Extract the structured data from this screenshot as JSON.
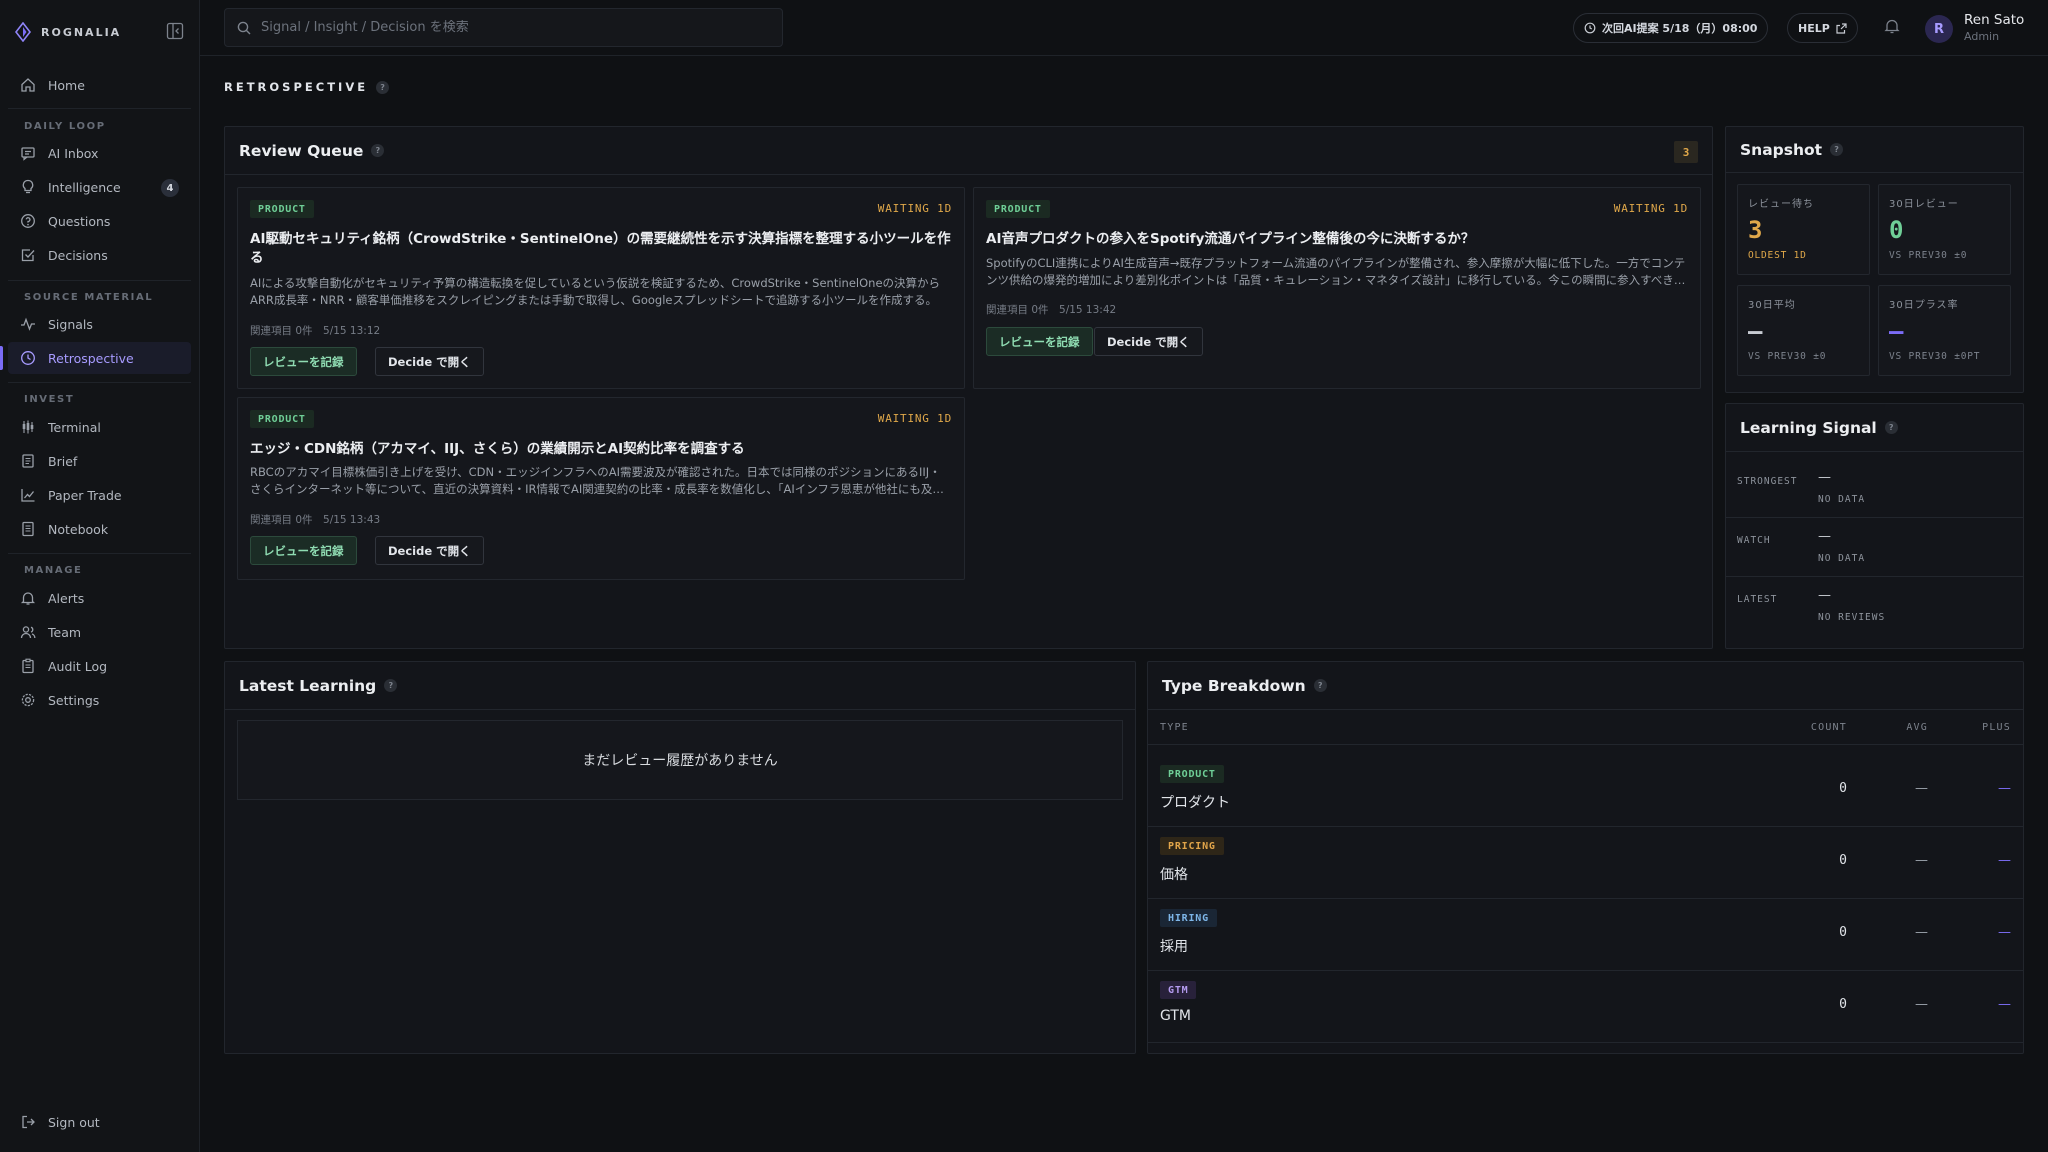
{
  "brand": {
    "name": "ROGNALIA",
    "accent": "#7b6cf6"
  },
  "sidebar": {
    "home": {
      "label": "Home",
      "icon": "home-icon"
    },
    "sections": {
      "daily_loop": "DAILY LOOP",
      "source_material": "SOURCE MATERIAL",
      "invest": "INVEST",
      "manage": "MANAGE"
    },
    "daily_loop": [
      {
        "label": "AI Inbox",
        "icon": "inbox-icon"
      },
      {
        "label": "Intelligence",
        "icon": "lightbulb-icon",
        "badge": "4"
      },
      {
        "label": "Questions",
        "icon": "question-icon"
      },
      {
        "label": "Decisions",
        "icon": "check-square-icon"
      }
    ],
    "source_material": [
      {
        "label": "Signals",
        "icon": "pulse-icon"
      },
      {
        "label": "Retrospective",
        "icon": "clock-icon",
        "active": true
      }
    ],
    "invest": [
      {
        "label": "Terminal",
        "icon": "candles-icon"
      },
      {
        "label": "Brief",
        "icon": "document-icon"
      },
      {
        "label": "Paper Trade",
        "icon": "chart-line-icon"
      },
      {
        "label": "Notebook",
        "icon": "notebook-icon"
      }
    ],
    "manage": [
      {
        "label": "Alerts",
        "icon": "bell-icon"
      },
      {
        "label": "Team",
        "icon": "users-icon"
      },
      {
        "label": "Audit Log",
        "icon": "clipboard-icon"
      },
      {
        "label": "Settings",
        "icon": "gear-icon"
      }
    ],
    "signout": "Sign out"
  },
  "topbar": {
    "search_placeholder": "Signal / Insight / Decision を検索",
    "next_ai": "次回AI提案 5/18（月）08:00",
    "help": "HELP",
    "user": {
      "initial": "R",
      "name": "Ren Sato",
      "role": "Admin"
    }
  },
  "page": {
    "title": "RETROSPECTIVE",
    "help": "?"
  },
  "review_queue": {
    "title": "Review Queue",
    "count": "3",
    "cards": [
      {
        "tag": "PRODUCT",
        "status": "WAITING 1D",
        "title": "AI駆動セキュリティ銘柄（CrowdStrike・SentinelOne）の需要継続性を示す決算指標を整理する小ツールを作る",
        "body": "AIによる攻撃自動化がセキュリティ予算の構造転換を促しているという仮説を検証するため、CrowdStrike・SentinelOneの決算からARR成長率・NRR・顧客単価推移をスクレイピングまたは手動で取得し、Googleスプレッドシートで追跡する小ツールを作成する。",
        "meta": "関連項目 0件　5/15 13:12",
        "btn_review": "レビューを記録",
        "btn_decide": "Decide で開く"
      },
      {
        "tag": "PRODUCT",
        "status": "WAITING 1D",
        "title": "AI音声プロダクトの参入をSpotify流通パイプライン整備後の今に決断するか？",
        "body": "SpotifyのCLI連携によりAI生成音声→既存プラットフォーム流通のパイプラインが整備され、参入摩擦が大幅に低下した。一方でコンテンツ供給の爆発的増加により差別化ポイントは「品質・キュレーション・マネタイズ設計」に移行している。今この瞬間に参入すべきか。",
        "meta": "関連項目 0件　5/15 13:42",
        "btn_review": "レビューを記録",
        "btn_decide": "Decide で開く"
      },
      {
        "tag": "PRODUCT",
        "status": "WAITING 1D",
        "title": "エッジ・CDN銘柄（アカマイ、IIJ、さくら）の業績開示とAI契約比率を調査する",
        "body": "RBCのアカマイ目標株価引き上げを受け、CDN・エッジインフラへのAI需要波及が確認された。日本では同様のポジションにあるIIJ・さくらインターネット等について、直近の決算資料・IR情報でAI関連契約の比率・成長率を数値化し、「AIインフラ恩恵が他社にも及ぶか」を検証する。",
        "meta": "関連項目 0件　5/15 13:43",
        "btn_review": "レビューを記録",
        "btn_decide": "Decide で開く"
      }
    ]
  },
  "snapshot": {
    "title": "Snapshot",
    "stats": [
      {
        "label": "レビュー待ち",
        "value": "3",
        "sub": "OLDEST 1D",
        "color": "#e0a84a",
        "sub_color": "#e0a84a"
      },
      {
        "label": "30日レビュー",
        "value": "0",
        "sub": "VS PREV30 ±0",
        "color": "#6fcf97",
        "sub_color": "#7d838d"
      },
      {
        "label": "30日平均",
        "value": "—",
        "sub": "VS PREV30 ±0",
        "color": "#c7cbd2",
        "sub_color": "#7d838d"
      },
      {
        "label": "30日プラス率",
        "value": "—",
        "sub": "VS PREV30 ±0PT",
        "color": "#7b6cf6",
        "sub_color": "#7d838d"
      }
    ]
  },
  "learning_signal": {
    "title": "Learning Signal",
    "rows": [
      {
        "label": "STRONGEST",
        "value": "—",
        "sub": "NO DATA"
      },
      {
        "label": "WATCH",
        "value": "—",
        "sub": "NO DATA"
      },
      {
        "label": "LATEST",
        "value": "—",
        "sub": "NO REVIEWS"
      }
    ]
  },
  "latest_learning": {
    "title": "Latest Learning",
    "empty": "まだレビュー履歴がありません"
  },
  "type_breakdown": {
    "title": "Type Breakdown",
    "headers": {
      "type": "TYPE",
      "count": "COUNT",
      "avg": "AVG",
      "plus": "PLUS"
    },
    "rows": [
      {
        "tag": "PRODUCT",
        "name": "プロダクト",
        "count": "0",
        "avg": "—",
        "plus": "—",
        "cls": "product"
      },
      {
        "tag": "PRICING",
        "name": "価格",
        "count": "0",
        "avg": "—",
        "plus": "—",
        "cls": "pricing"
      },
      {
        "tag": "HIRING",
        "name": "採用",
        "count": "0",
        "avg": "—",
        "plus": "—",
        "cls": "hiring"
      },
      {
        "tag": "GTM",
        "name": "GTM",
        "count": "0",
        "avg": "—",
        "plus": "—",
        "cls": "gtm"
      }
    ]
  }
}
